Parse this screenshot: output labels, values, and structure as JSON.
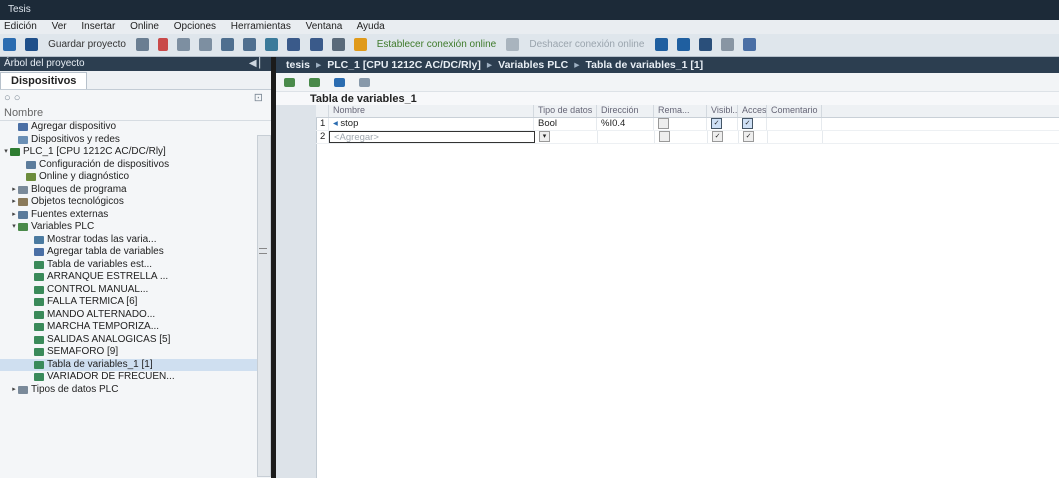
{
  "title": "Tesis",
  "menu": [
    "Edición",
    "Ver",
    "Insertar",
    "Online",
    "Opciones",
    "Herramientas",
    "Ventana",
    "Ayuda"
  ],
  "toolbar": {
    "save_label": "Guardar proyecto",
    "online_label": "Establecer conexión online",
    "offline_label": "Deshacer conexión online"
  },
  "left_panel": {
    "header": "Árbol del proyecto",
    "tab": "Dispositivos",
    "tree_header": "Nombre",
    "items": [
      {
        "label": "Agregar dispositivo",
        "color": "#4a6fa5"
      },
      {
        "label": "Dispositivos y redes",
        "color": "#6a8fb5"
      },
      {
        "label": "PLC_1 [CPU 1212C AC/DC/Rly]",
        "color": "#2e7d32"
      },
      {
        "label": "Configuración de dispositivos",
        "color": "#5c7c9c"
      },
      {
        "label": "Online y diagnóstico",
        "color": "#6c8c3c"
      },
      {
        "label": "Bloques de programa",
        "color": "#7a8a9a"
      },
      {
        "label": "Objetos tecnológicos",
        "color": "#8a7a5a"
      },
      {
        "label": "Fuentes externas",
        "color": "#5a7a9a"
      },
      {
        "label": "Variables PLC",
        "color": "#4a8a4a"
      },
      {
        "label": "Mostrar todas las varia...",
        "color": "#4a7aa0"
      },
      {
        "label": "Agregar tabla de variables",
        "color": "#4a6fa5"
      },
      {
        "label": "Tabla de variables est...",
        "color": "#3a8a5a"
      },
      {
        "label": "ARRANQUE ESTRELLA ...",
        "color": "#3a8a5a"
      },
      {
        "label": "CONTROL MANUAL...",
        "color": "#3a8a5a"
      },
      {
        "label": "FALLA TERMICA [6]",
        "color": "#3a8a5a"
      },
      {
        "label": "MANDO ALTERNADO...",
        "color": "#3a8a5a"
      },
      {
        "label": "MARCHA TEMPORIZA...",
        "color": "#3a8a5a"
      },
      {
        "label": "SALIDAS ANALOGICAS [5]",
        "color": "#3a8a5a"
      },
      {
        "label": "SEMAFORO [9]",
        "color": "#3a8a5a"
      },
      {
        "label": "Tabla de variables_1 [1]",
        "color": "#3a8a5a"
      },
      {
        "label": "VARIADOR DE FRECUEN...",
        "color": "#3a8a5a"
      },
      {
        "label": "Tipos de datos PLC",
        "color": "#7a8a9a"
      }
    ]
  },
  "breadcrumb": [
    "tesis",
    "PLC_1 [CPU 1212C AC/DC/Rly]",
    "Variables PLC",
    "Tabla de variables_1 [1]"
  ],
  "table": {
    "title": "Tabla de variables_1",
    "columns": [
      "",
      "Nombre",
      "Tipo de datos",
      "Dirección",
      "Rema...",
      "Visibl...",
      "Acces...",
      "Comentario"
    ],
    "rows": [
      {
        "num": "1",
        "name": "stop",
        "type": "Bool",
        "address": "%I0.4",
        "rema": false,
        "visible": true,
        "access": true
      },
      {
        "num": "2",
        "name": "<Agregar>",
        "type": "",
        "address": "",
        "rema": false,
        "visible": true,
        "access": true
      }
    ]
  }
}
